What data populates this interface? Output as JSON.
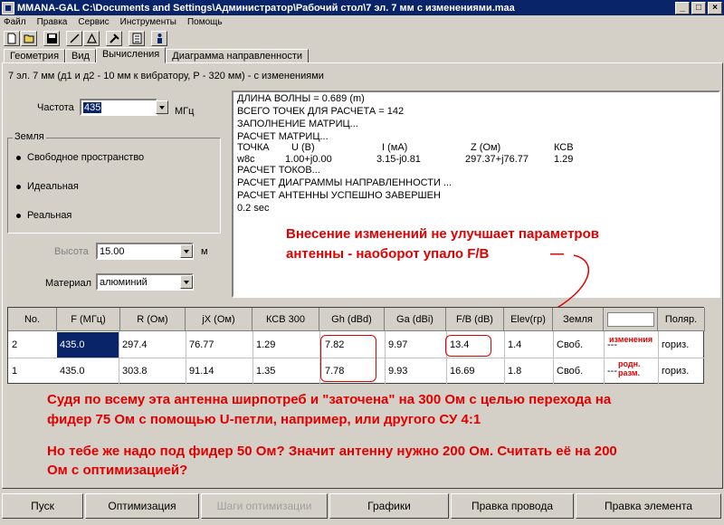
{
  "window": {
    "title": "MMANA-GAL C:\\Documents and Settings\\Администратор\\Рабочий стол\\7 эл. 7 мм  с изменениями.maa",
    "minimize": "_",
    "maximize": "□",
    "close": "×"
  },
  "menu": [
    "Файл",
    "Правка",
    "Сервис",
    "Инструменты",
    "Помощь"
  ],
  "toolbar": [
    "new-file-icon",
    "open-folder-icon",
    "save-icon",
    "line-tool-icon",
    "triangle-tool-icon",
    "tools-icon",
    "calculator-icon",
    "person-icon"
  ],
  "tabs": [
    {
      "label": "Геометрия",
      "active": false
    },
    {
      "label": "Вид",
      "active": false
    },
    {
      "label": "Вычисления",
      "active": true
    },
    {
      "label": "Диаграмма направленности",
      "active": false
    }
  ],
  "project_title": "7 эл. 7 мм (д1 и д2 - 10 мм к вибратору, Р - 320 мм) - с изменениями",
  "frequency": {
    "label": "Частота",
    "value": "435",
    "unit": "МГц"
  },
  "ground": {
    "title": "Земля",
    "options": [
      {
        "label": "Свободное пространство",
        "selected": true
      },
      {
        "label": "Идеальная",
        "selected": false
      },
      {
        "label": "Реальная",
        "selected": false
      }
    ]
  },
  "height": {
    "label": "Высота",
    "value": "15.00",
    "unit": "м"
  },
  "material": {
    "label": "Материал",
    "value": "алюминий"
  },
  "output": {
    "lines": [
      "ДЛИНА ВОЛНЫ = 0.689 (m)",
      "ВСЕГО ТОЧЕК ДЛЯ РАСЧЕТА = 142",
      "ЗАПОЛНЕНИЕ МАТРИЦ...",
      "РАСЧЕТ МАТРИЦ...",
      "РАСЧЕТ ТОКОВ...",
      "РАСЧЕТ ДИАГРАММЫ НАПРАВЛЕННОСТИ ...",
      "РАСЧЕТ АНТЕННЫ УСПЕШНО ЗАВЕРШЕН",
      "0.2 sec"
    ],
    "table_header": [
      "ТОЧКА",
      "U (В)",
      "I (мА)",
      "Z (Ом)",
      "КСВ"
    ],
    "table_row": [
      "w8c",
      "1.00+j0.00",
      "3.15-j0.81",
      "297.37+j76.77",
      "1.29"
    ]
  },
  "annotation_top": [
    "Внесение изменений не улучшает параметров",
    "антенны - наоборот упало F/B"
  ],
  "annotation_arrow_tail": "—",
  "grid": {
    "headers": [
      "No.",
      "F (МГц)",
      "R (Ом)",
      "jX (Ом)",
      "КСВ 300",
      "Gh (dBd)",
      "Ga (dBi)",
      "F/B (dB)",
      "Elev(гр)",
      "Земля",
      "",
      "Поляр."
    ],
    "rows": [
      [
        "2",
        "435.0",
        "297.4",
        "76.77",
        "1.29",
        "7.82",
        "9.97",
        "13.4",
        "1.4",
        "Своб.",
        "---",
        "гориз."
      ],
      [
        "1",
        "435.0",
        "303.8",
        "91.14",
        "1.35",
        "7.78",
        "9.93",
        "16.69",
        "1.8",
        "Своб.",
        "---",
        "гориз."
      ]
    ],
    "row_notes": [
      "изменения",
      "родн.\nразм."
    ]
  },
  "annotation_bottom": [
    "Судя по всему эта антенна ширпотреб и \"заточена\" на 300 Ом с целью перехода на",
    "фидер 75 Ом с помощью U-петли, например, или другого СУ 4:1",
    "Но тебе же надо под фидер 50 Ом? Значит антенну нужно 200 Ом. Считать её на 200",
    "Ом с оптимизацией?"
  ],
  "buttons": [
    {
      "label": "Пуск",
      "enabled": true
    },
    {
      "label": "Оптимизация",
      "enabled": true
    },
    {
      "label": "Шаги оптимизации",
      "enabled": false
    },
    {
      "label": "Графики",
      "enabled": true
    },
    {
      "label": "Правка провода",
      "enabled": true
    },
    {
      "label": "Правка элемента",
      "enabled": true
    }
  ],
  "colors": {
    "annotation": "#e00000",
    "titlebar": "#0a246a",
    "selection": "#0a246a"
  }
}
